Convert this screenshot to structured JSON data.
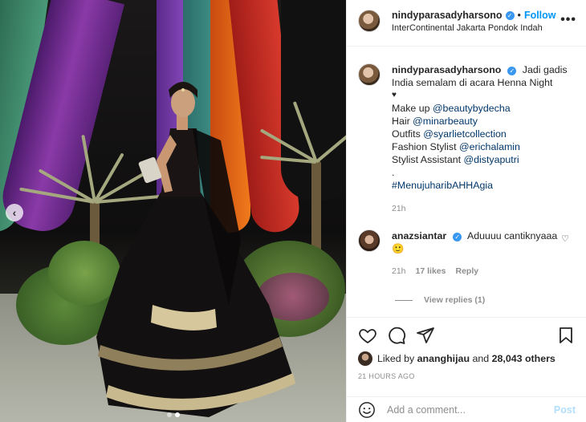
{
  "post": {
    "username": "nindyparasadyharsono",
    "verified": true,
    "follow_label": "Follow",
    "separator": "•",
    "location": "InterContinental Jakarta Pondok Indah",
    "more_icon": "more-options-icon",
    "carousel": {
      "slides": 2,
      "active_index": 1
    }
  },
  "caption": {
    "username": "nindyparasadyharsono",
    "text_line1": "Jadi gadis India semalam di acara Henna Night",
    "heart": "♥",
    "lines": [
      {
        "prefix": "Make up ",
        "mention": "@beautybydecha"
      },
      {
        "prefix": "Hair ",
        "mention": "@minarbeauty"
      },
      {
        "prefix": "Outfits ",
        "mention": "@syarlietcollection"
      },
      {
        "prefix": "Fashion Stylist ",
        "mention": "@erichalamin"
      },
      {
        "prefix": "Stylist Assistant ",
        "mention": "@distyaputri"
      }
    ],
    "dot": ".",
    "hashtag": "#MenujuharibAHHAgia",
    "age": "21h"
  },
  "comment": {
    "username": "anazsiantar",
    "verified": true,
    "text": "Aduuuu cantiknyaaa 🙂",
    "age": "21h",
    "likes": "17 likes",
    "reply_label": "Reply",
    "view_replies": "View replies (1)"
  },
  "actions": {
    "liked_by_prefix": "Liked by ",
    "liked_by_user": "ananghijau",
    "liked_by_suffix": " and ",
    "others": "28,043 others",
    "timestamp": "21 HOURS AGO"
  },
  "add_comment": {
    "placeholder": "Add a comment...",
    "post_label": "Post"
  },
  "colors": {
    "link_blue": "#0095f6",
    "mention": "#00376b",
    "muted": "#8e8e8e",
    "verified": "#3897f0"
  }
}
